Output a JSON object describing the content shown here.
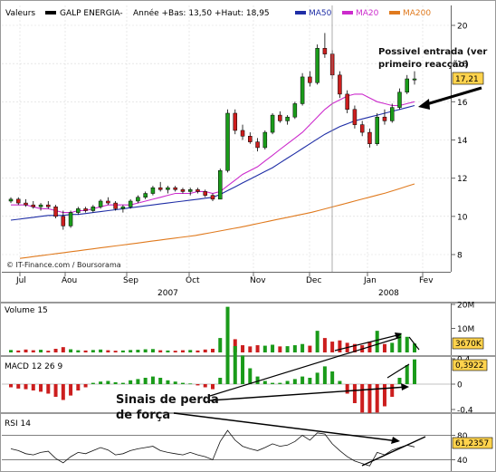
{
  "header": {
    "label": "Valeurs",
    "ticker": "GALP ENERGIA-",
    "stats": "Année +Bas: 13,50 +Haut: 18,95",
    "ma50": "MA50",
    "ma20": "MA20",
    "ma200": "MA200"
  },
  "colors": {
    "up": "#1a9b1a",
    "down": "#cc1e1e",
    "ma50": "#1f2ea6",
    "ma20": "#cc2bcc",
    "ma200": "#e07a1e",
    "price_tag_bg": "#ffd34d",
    "grid": "#d9d9d9"
  },
  "footer": {
    "source": "© IT-Finance.com / Boursorama",
    "year_left": "2007",
    "year_right": "2008"
  },
  "chart_data": [
    {
      "id": "price",
      "type": "candlestick",
      "title": "GALP ENERGIA-",
      "x_ticks": [
        "Jul",
        "Aou",
        "Sep",
        "Oct",
        "Nov",
        "Dec",
        "Jan",
        "Fev"
      ],
      "y_ticks": [
        8,
        10,
        12,
        14,
        16,
        18,
        20
      ],
      "ylim": [
        7.5,
        20.5
      ],
      "grid": true,
      "last_price_label": "17,21",
      "candles": [
        [
          10.8,
          11.0,
          10.7,
          10.9
        ],
        [
          10.9,
          11.0,
          10.6,
          10.7
        ],
        [
          10.7,
          10.9,
          10.5,
          10.6
        ],
        [
          10.6,
          10.8,
          10.4,
          10.5
        ],
        [
          10.5,
          10.7,
          10.3,
          10.6
        ],
        [
          10.6,
          10.8,
          10.4,
          10.5
        ],
        [
          10.5,
          10.6,
          9.9,
          10.0
        ],
        [
          10.0,
          10.3,
          9.3,
          9.5
        ],
        [
          9.5,
          10.3,
          9.4,
          10.2
        ],
        [
          10.2,
          10.5,
          10.1,
          10.4
        ],
        [
          10.4,
          10.5,
          10.2,
          10.3
        ],
        [
          10.3,
          10.6,
          10.2,
          10.5
        ],
        [
          10.5,
          10.9,
          10.4,
          10.8
        ],
        [
          10.8,
          11.0,
          10.6,
          10.7
        ],
        [
          10.7,
          10.8,
          10.3,
          10.4
        ],
        [
          10.4,
          10.6,
          10.2,
          10.5
        ],
        [
          10.5,
          10.9,
          10.4,
          10.8
        ],
        [
          10.8,
          11.1,
          10.7,
          11.0
        ],
        [
          11.0,
          11.3,
          10.9,
          11.2
        ],
        [
          11.2,
          11.6,
          11.1,
          11.5
        ],
        [
          11.5,
          11.8,
          11.3,
          11.4
        ],
        [
          11.4,
          11.6,
          11.2,
          11.5
        ],
        [
          11.5,
          11.6,
          11.3,
          11.4
        ],
        [
          11.4,
          11.5,
          11.2,
          11.3
        ],
        [
          11.3,
          11.5,
          11.1,
          11.4
        ],
        [
          11.4,
          11.5,
          11.2,
          11.3
        ],
        [
          11.3,
          11.4,
          11.0,
          11.1
        ],
        [
          11.1,
          11.2,
          10.8,
          10.9
        ],
        [
          10.9,
          12.5,
          10.9,
          12.4
        ],
        [
          12.4,
          15.6,
          12.3,
          15.4
        ],
        [
          15.4,
          15.6,
          14.3,
          14.5
        ],
        [
          14.5,
          14.8,
          14.0,
          14.2
        ],
        [
          14.2,
          14.4,
          13.8,
          13.9
        ],
        [
          13.9,
          14.1,
          13.4,
          13.6
        ],
        [
          13.6,
          14.5,
          13.5,
          14.4
        ],
        [
          14.4,
          15.4,
          14.3,
          15.3
        ],
        [
          15.3,
          15.5,
          14.9,
          15.0
        ],
        [
          15.0,
          15.3,
          14.8,
          15.2
        ],
        [
          15.2,
          16.0,
          15.1,
          15.9
        ],
        [
          15.9,
          17.5,
          15.8,
          17.3
        ],
        [
          17.3,
          17.6,
          16.8,
          17.0
        ],
        [
          17.0,
          19.0,
          16.9,
          18.8
        ],
        [
          18.8,
          19.6,
          18.3,
          18.5
        ],
        [
          18.5,
          18.7,
          17.2,
          17.4
        ],
        [
          17.4,
          17.6,
          16.2,
          16.4
        ],
        [
          16.4,
          16.6,
          15.4,
          15.6
        ],
        [
          15.6,
          15.8,
          14.6,
          14.8
        ],
        [
          14.8,
          15.0,
          14.2,
          14.4
        ],
        [
          14.4,
          14.6,
          13.6,
          13.8
        ],
        [
          13.8,
          15.4,
          13.7,
          15.2
        ],
        [
          15.2,
          15.6,
          14.8,
          15.0
        ],
        [
          15.0,
          15.9,
          14.9,
          15.7
        ],
        [
          15.7,
          16.7,
          15.6,
          16.5
        ],
        [
          16.5,
          17.4,
          16.4,
          17.2
        ],
        [
          17.2,
          17.6,
          16.9,
          17.2
        ]
      ],
      "series": [
        {
          "name": "MA20",
          "values": [
            10.6,
            10.6,
            10.6,
            10.5,
            10.4,
            10.4,
            10.3,
            10.2,
            10.2,
            10.3,
            10.3,
            10.4,
            10.5,
            10.6,
            10.6,
            10.6,
            10.6,
            10.7,
            10.8,
            10.9,
            11.0,
            11.1,
            11.2,
            11.2,
            11.2,
            11.3,
            11.3,
            11.2,
            11.3,
            11.6,
            11.9,
            12.2,
            12.4,
            12.6,
            12.9,
            13.2,
            13.5,
            13.8,
            14.1,
            14.4,
            14.8,
            15.2,
            15.6,
            15.9,
            16.1,
            16.3,
            16.4,
            16.4,
            16.2,
            16.0,
            15.9,
            15.8,
            15.8,
            15.9,
            16.0
          ]
        },
        {
          "name": "MA50",
          "values": [
            9.8,
            9.85,
            9.9,
            9.95,
            10.0,
            10.05,
            10.05,
            10.05,
            10.1,
            10.1,
            10.15,
            10.2,
            10.25,
            10.3,
            10.35,
            10.4,
            10.45,
            10.5,
            10.55,
            10.6,
            10.65,
            10.7,
            10.75,
            10.8,
            10.85,
            10.9,
            10.95,
            11.0,
            11.15,
            11.35,
            11.55,
            11.75,
            11.95,
            12.15,
            12.35,
            12.55,
            12.8,
            13.05,
            13.3,
            13.55,
            13.8,
            14.05,
            14.3,
            14.5,
            14.7,
            14.85,
            15.0,
            15.1,
            15.2,
            15.3,
            15.4,
            15.5,
            15.6,
            15.7,
            15.8
          ]
        },
        {
          "name": "MA200",
          "values": [
            7.8,
            7.85,
            7.9,
            7.95,
            8.0,
            8.05,
            8.1,
            8.15,
            8.2,
            8.25,
            8.3,
            8.35,
            8.4,
            8.45,
            8.5,
            8.55,
            8.6,
            8.65,
            8.7,
            8.75,
            8.8,
            8.85,
            8.9,
            8.95,
            9.0,
            9.07,
            9.14,
            9.21,
            9.28,
            9.35,
            9.42,
            9.5,
            9.58,
            9.66,
            9.74,
            9.82,
            9.9,
            9.98,
            10.06,
            10.14,
            10.22,
            10.32,
            10.42,
            10.52,
            10.62,
            10.72,
            10.82,
            10.92,
            11.02,
            11.12,
            11.22,
            11.34,
            11.46,
            11.58,
            11.7
          ]
        }
      ],
      "annotations": [
        "Possivel entrada (ver",
        "primeiro reacção)"
      ]
    },
    {
      "id": "volume",
      "type": "bar",
      "title": "Volume 15",
      "y_ticks": [
        "10M",
        "20M"
      ],
      "ylim": [
        0,
        20
      ],
      "last_value_label": "3670K",
      "values": [
        1.0,
        0.8,
        1.2,
        0.9,
        1.1,
        0.7,
        1.5,
        2.2,
        1.3,
        0.9,
        0.8,
        1.0,
        1.2,
        0.9,
        0.7,
        0.8,
        1.0,
        1.1,
        1.3,
        1.4,
        0.9,
        0.8,
        0.7,
        0.9,
        1.0,
        0.8,
        1.2,
        1.5,
        6.0,
        19.0,
        5.5,
        3.0,
        2.5,
        3.0,
        2.8,
        3.2,
        2.5,
        2.6,
        3.0,
        3.5,
        2.8,
        9.0,
        6.0,
        4.5,
        5.0,
        4.0,
        3.5,
        3.0,
        4.5,
        9.0,
        3.5,
        4.0,
        8.0,
        6.5,
        3.7
      ],
      "up": [
        1,
        0,
        0,
        0,
        1,
        0,
        0,
        0,
        1,
        1,
        0,
        1,
        1,
        0,
        0,
        1,
        1,
        1,
        1,
        1,
        0,
        1,
        0,
        0,
        1,
        0,
        0,
        0,
        1,
        1,
        0,
        0,
        0,
        0,
        1,
        1,
        0,
        1,
        1,
        1,
        0,
        1,
        0,
        0,
        0,
        0,
        0,
        0,
        0,
        1,
        0,
        1,
        1,
        1,
        1
      ]
    },
    {
      "id": "macd",
      "type": "bar",
      "title": "MACD 12 26 9",
      "y_ticks": [
        "-0,4",
        "0",
        "0,4"
      ],
      "ylim": [
        -0.75,
        0.75
      ],
      "last_value_label": "0,3922",
      "values": [
        -0.05,
        -0.07,
        -0.08,
        -0.1,
        -0.12,
        -0.15,
        -0.2,
        -0.25,
        -0.18,
        -0.1,
        -0.05,
        0.02,
        0.04,
        0.05,
        0.03,
        0.02,
        0.06,
        0.08,
        0.1,
        0.12,
        0.1,
        0.06,
        0.04,
        0.02,
        0.01,
        -0.02,
        -0.05,
        -0.08,
        0.1,
        0.55,
        0.6,
        0.45,
        0.25,
        0.12,
        0.05,
        0.02,
        0.02,
        0.05,
        0.08,
        0.12,
        0.1,
        0.18,
        0.28,
        0.2,
        0.05,
        -0.15,
        -0.3,
        -0.45,
        -0.55,
        -0.45,
        -0.35,
        -0.2,
        0.1,
        0.3,
        0.39
      ]
    },
    {
      "id": "rsi",
      "type": "line",
      "title": "RSI 14",
      "y_ticks": [
        40,
        80
      ],
      "ylim": [
        24,
        96
      ],
      "last_value_label": "61,2357",
      "values": [
        58,
        55,
        50,
        48,
        52,
        54,
        42,
        35,
        45,
        52,
        50,
        55,
        60,
        56,
        48,
        50,
        55,
        58,
        60,
        62,
        55,
        52,
        50,
        48,
        52,
        48,
        45,
        40,
        70,
        88,
        72,
        62,
        58,
        55,
        60,
        66,
        62,
        64,
        70,
        80,
        72,
        84,
        82,
        66,
        55,
        45,
        38,
        34,
        30,
        52,
        48,
        56,
        60,
        64,
        61
      ]
    }
  ],
  "overlay_text": {
    "perda_line1": "Sinais de perda",
    "perda_line2": "de força"
  }
}
